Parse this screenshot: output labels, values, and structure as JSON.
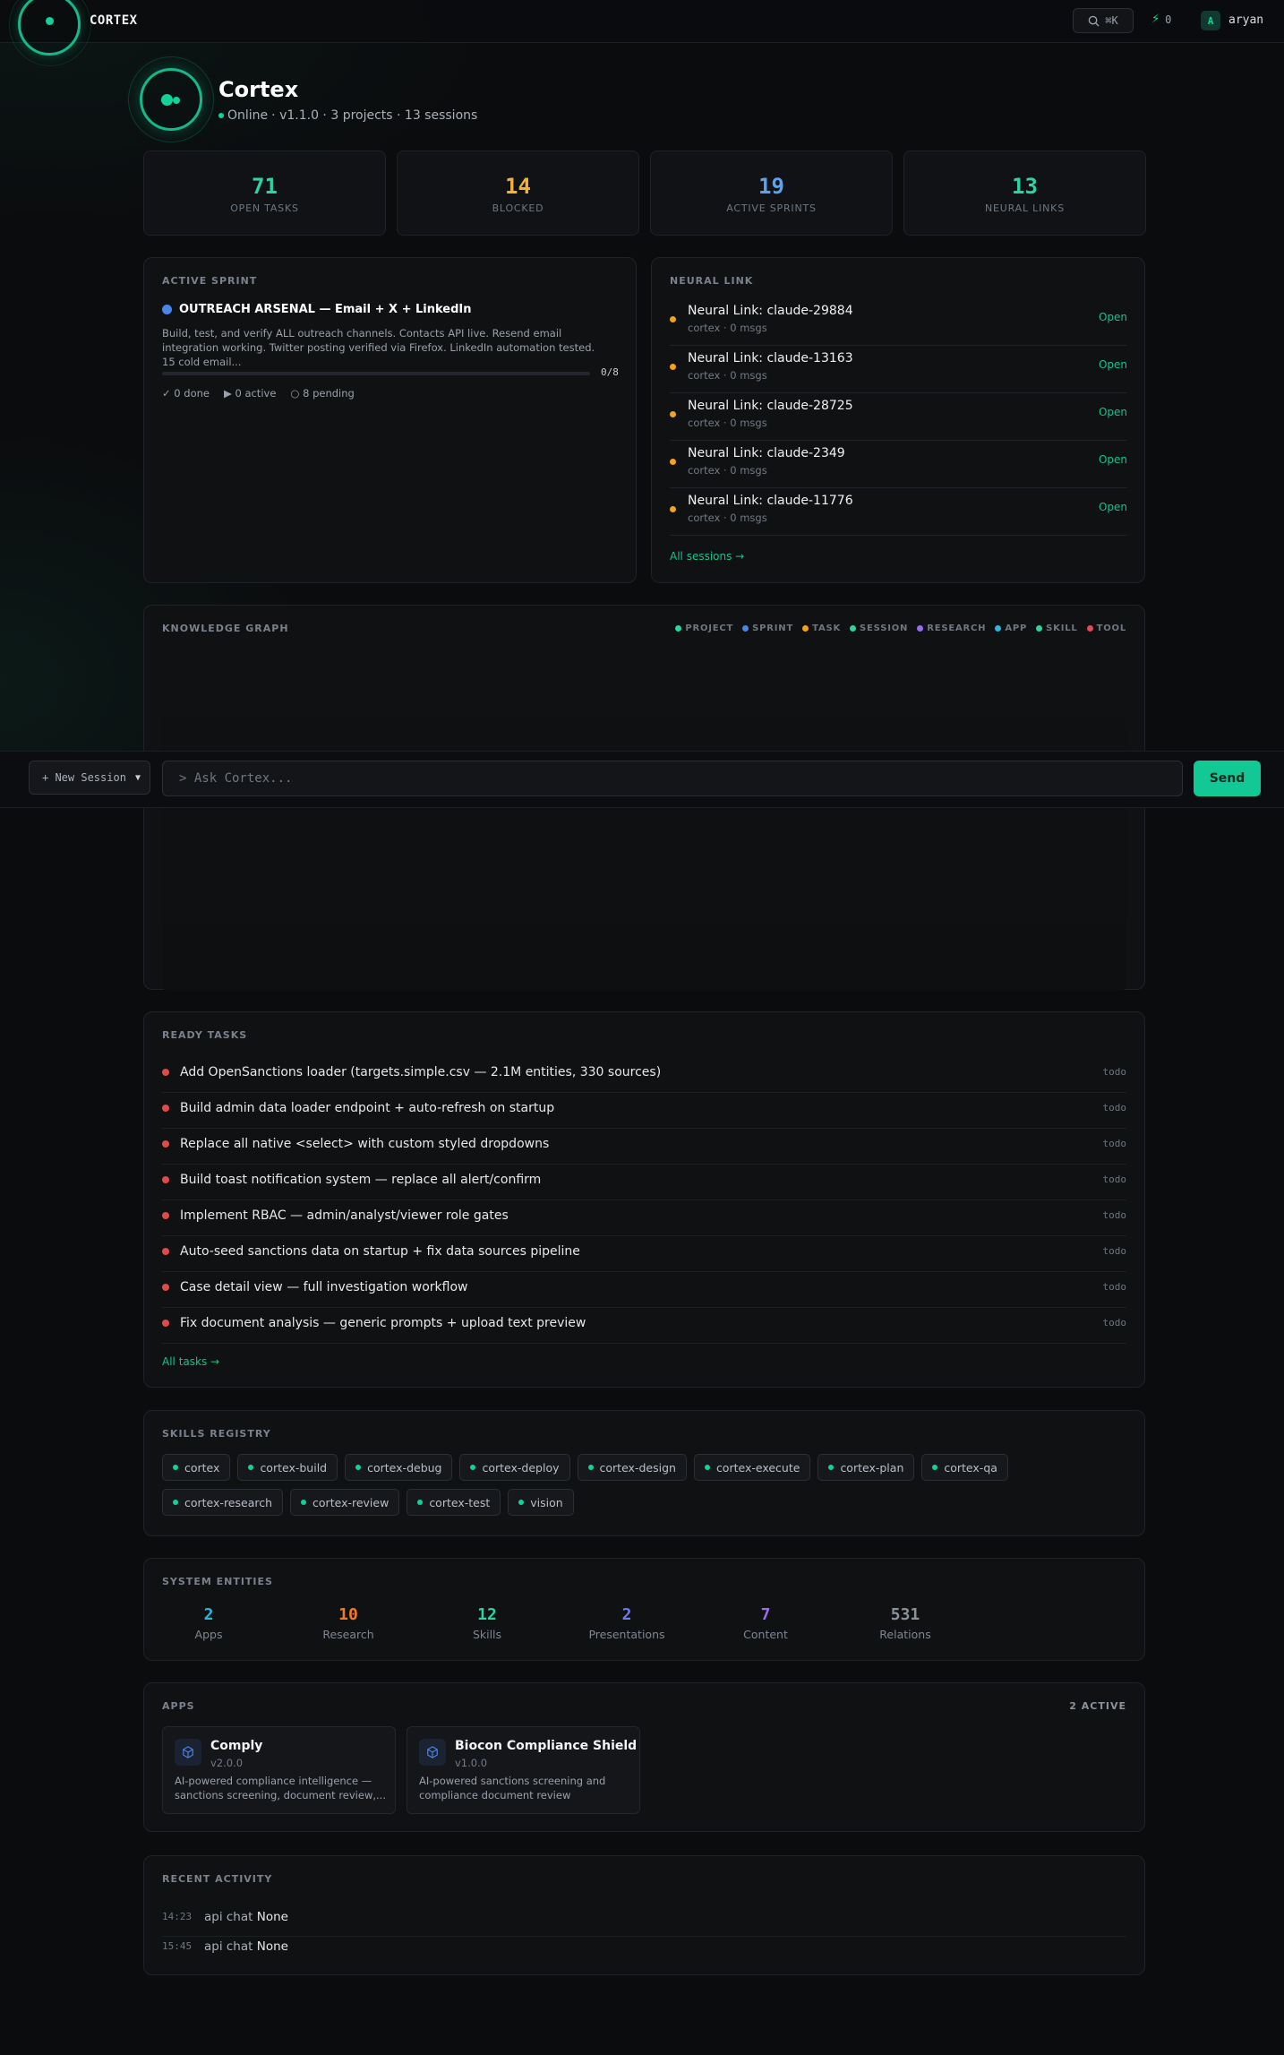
{
  "topbar": {
    "brand": "CORTEX",
    "search_shortcut": "⌘K",
    "bolt_count": "0",
    "avatar_initial": "A",
    "username": "aryan"
  },
  "header": {
    "title": "Cortex",
    "status": "Online",
    "meta": "· v1.1.0 · 3 projects · 13 sessions"
  },
  "stats": [
    {
      "value": "71",
      "label": "OPEN TASKS",
      "color": "#2bd59d"
    },
    {
      "value": "14",
      "label": "BLOCKED",
      "color": "#f2b13a"
    },
    {
      "value": "19",
      "label": "ACTIVE SPRINTS",
      "color": "#5aa3f0"
    },
    {
      "value": "13",
      "label": "NEURAL LINKS",
      "color": "#2bd59d"
    }
  ],
  "sprint": {
    "section_title": "ACTIVE SPRINT",
    "name": "OUTREACH ARSENAL — Email + X + LinkedIn",
    "description": "Build, test, and verify ALL outreach channels. Contacts API live. Resend email integration working. Twitter posting verified via Firefox. LinkedIn automation tested. 15 cold email...",
    "progress": "0/8",
    "progress_fraction": 0,
    "done": "✓ 0 done",
    "active": "▶ 0 active",
    "pending": "○ 8 pending"
  },
  "neural": {
    "section_title": "NEURAL LINK",
    "items": [
      {
        "title": "Neural Link: claude-29884",
        "sub": "cortex · 0 msgs",
        "action": "Open"
      },
      {
        "title": "Neural Link: claude-13163",
        "sub": "cortex · 0 msgs",
        "action": "Open"
      },
      {
        "title": "Neural Link: claude-28725",
        "sub": "cortex · 0 msgs",
        "action": "Open"
      },
      {
        "title": "Neural Link: claude-2349",
        "sub": "cortex · 0 msgs",
        "action": "Open"
      },
      {
        "title": "Neural Link: claude-11776",
        "sub": "cortex · 0 msgs",
        "action": "Open"
      }
    ],
    "all_link": "All sessions →"
  },
  "graph": {
    "section_title": "KNOWLEDGE GRAPH",
    "legend": [
      {
        "label": "PROJECT",
        "color": "#2bd59d"
      },
      {
        "label": "SPRINT",
        "color": "#4a86e8"
      },
      {
        "label": "TASK",
        "color": "#f2a31b"
      },
      {
        "label": "SESSION",
        "color": "#2bd59d"
      },
      {
        "label": "RESEARCH",
        "color": "#9b6cf0"
      },
      {
        "label": "APP",
        "color": "#2bb6e0"
      },
      {
        "label": "SKILL",
        "color": "#2bd59d"
      },
      {
        "label": "TOOL",
        "color": "#e24a5a"
      }
    ]
  },
  "chat": {
    "new_session": "+ New Session",
    "placeholder": "> Ask Cortex...",
    "send": "Send"
  },
  "tasks": {
    "section_title": "READY TASKS",
    "items": [
      {
        "title": "Add OpenSanctions loader (targets.simple.csv — 2.1M entities, 330 sources)",
        "status": "todo"
      },
      {
        "title": "Build admin data loader endpoint + auto-refresh on startup",
        "status": "todo"
      },
      {
        "title": "Replace all native <select> with custom styled dropdowns",
        "status": "todo"
      },
      {
        "title": "Build toast notification system — replace all alert/confirm",
        "status": "todo"
      },
      {
        "title": "Implement RBAC — admin/analyst/viewer role gates",
        "status": "todo"
      },
      {
        "title": "Auto-seed sanctions data on startup + fix data sources pipeline",
        "status": "todo"
      },
      {
        "title": "Case detail view — full investigation workflow",
        "status": "todo"
      },
      {
        "title": "Fix document analysis — generic prompts + upload text preview",
        "status": "todo"
      }
    ],
    "all_link": "All tasks →"
  },
  "skills": {
    "section_title": "SKILLS REGISTRY",
    "items": [
      "cortex",
      "cortex-build",
      "cortex-debug",
      "cortex-deploy",
      "cortex-design",
      "cortex-execute",
      "cortex-plan",
      "cortex-qa",
      "cortex-research",
      "cortex-review",
      "cortex-test",
      "vision"
    ]
  },
  "entities": {
    "section_title": "SYSTEM ENTITIES",
    "items": [
      {
        "value": "2",
        "label": "Apps",
        "color": "#2bb6e0"
      },
      {
        "value": "10",
        "label": "Research",
        "color": "#f07a2b"
      },
      {
        "value": "12",
        "label": "Skills",
        "color": "#2bd59d"
      },
      {
        "value": "2",
        "label": "Presentations",
        "color": "#6b7cf0"
      },
      {
        "value": "7",
        "label": "Content",
        "color": "#9b6cf0"
      },
      {
        "value": "531",
        "label": "Relations",
        "color": "#8a929c"
      }
    ]
  },
  "apps": {
    "section_title": "APPS",
    "count": "2 ACTIVE",
    "items": [
      {
        "name": "Comply",
        "version": "v2.0.0",
        "description": "AI-powered compliance intelligence — sanctions screening, document review,..."
      },
      {
        "name": "Biocon Compliance Shield",
        "version": "v1.0.0",
        "description": "AI-powered sanctions screening and compliance document review"
      }
    ]
  },
  "activity": {
    "section_title": "RECENT ACTIVITY",
    "items": [
      {
        "time": "14:23",
        "text": "api chat",
        "value": "None"
      },
      {
        "time": "15:45",
        "text": "api chat",
        "value": "None"
      }
    ]
  }
}
